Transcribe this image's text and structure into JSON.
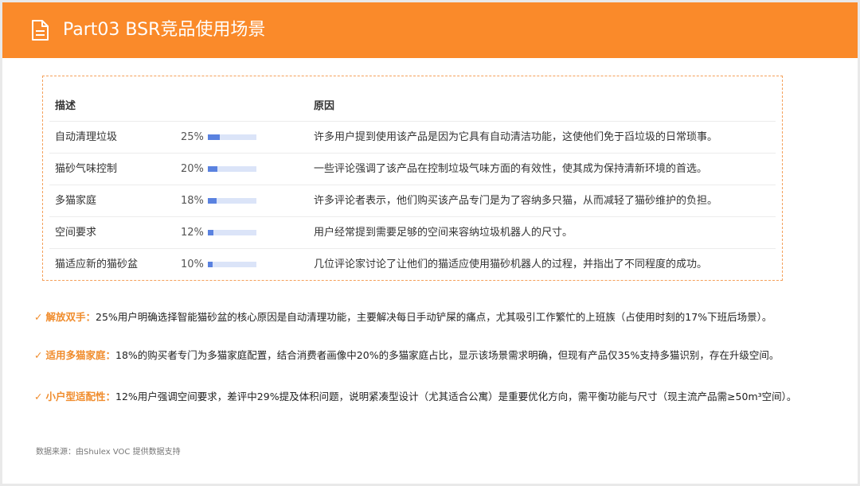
{
  "header": {
    "title": "Part03 BSR竞品使用场景",
    "icon": "document-icon",
    "background": "#fa8a2a"
  },
  "table": {
    "headers": {
      "desc": "描述",
      "reason": "原因"
    },
    "rows": [
      {
        "desc": "自动清理垃圾",
        "pct": "25%",
        "level": 0.25,
        "reason": "许多用户提到使用该产品是因为它具有自动清洁功能，这使他们免于舀垃圾的日常琐事。"
      },
      {
        "desc": "猫砂气味控制",
        "pct": "20%",
        "level": 0.2,
        "reason": "一些评论强调了该产品在控制垃圾气味方面的有效性，使其成为保持清新环境的首选。"
      },
      {
        "desc": "多猫家庭",
        "pct": "18%",
        "level": 0.18,
        "reason": "许多评论者表示，他们购买该产品专门是为了容纳多只猫，从而减轻了猫砂维护的负担。"
      },
      {
        "desc": "空间要求",
        "pct": "12%",
        "level": 0.12,
        "reason": "用户经常提到需要足够的空间来容纳垃圾机器人的尺寸。"
      },
      {
        "desc": "猫适应新的猫砂盆",
        "pct": "10%",
        "level": 0.1,
        "reason": "几位评论家讨论了让他们的猫适应使用猫砂机器人的过程，并指出了不同程度的成功。"
      }
    ]
  },
  "bullets": [
    {
      "check": "✓",
      "label": "解放双手：",
      "text": "25%用户明确选择智能猫砂盆的核心原因是自动清理功能，主要解决每日手动铲屎的痛点，尤其吸引工作繁忙的上班族（占使用时刻的17%下班后场景）。"
    },
    {
      "check": "✓",
      "label": "适用多猫家庭：",
      "text": "18%的购买者专门为多猫家庭配置，结合消费者画像中20%的多猫家庭占比，显示该场景需求明确，但现有产品仅35%支持多猫识别，存在升级空间。"
    },
    {
      "check": "✓",
      "label": "小户型适配性：",
      "text": "12%用户强调空间要求，差评中29%提及体积问题，说明紧凑型设计（尤其适合公寓）是重要优化方向，需平衡功能与尺寸（现主流产品需≥50m³空间）。"
    }
  ],
  "source": "数据来源：由Shulex VOC 提供数据支持"
}
